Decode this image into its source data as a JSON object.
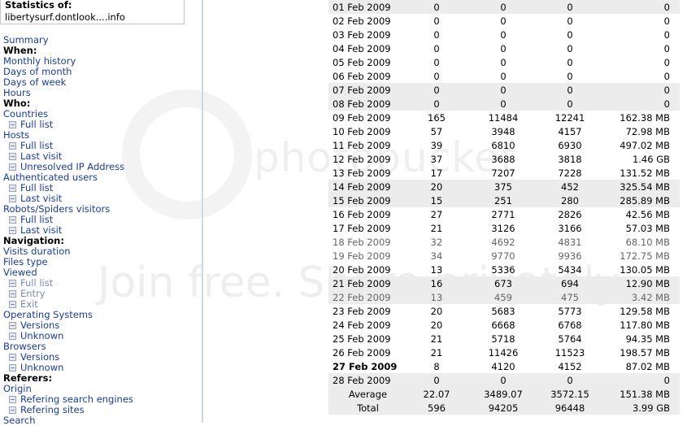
{
  "sidebar": {
    "stats_title": "Statistics of:",
    "site": "libertysurf.dontlook....info",
    "items": [
      {
        "label": "Summary",
        "kind": "l"
      },
      {
        "label": "When:",
        "kind": "h"
      },
      {
        "label": "Monthly history",
        "kind": "l"
      },
      {
        "label": "Days of month",
        "kind": "l"
      },
      {
        "label": "Days of week",
        "kind": "l"
      },
      {
        "label": "Hours",
        "kind": "l"
      },
      {
        "label": "Who:",
        "kind": "h"
      },
      {
        "label": "Countries",
        "kind": "l"
      },
      {
        "label": "Full list",
        "kind": "s"
      },
      {
        "label": "Hosts",
        "kind": "l"
      },
      {
        "label": "Full list",
        "kind": "s"
      },
      {
        "label": "Last visit",
        "kind": "s"
      },
      {
        "label": "Unresolved IP Address",
        "kind": "s"
      },
      {
        "label": "Authenticated users",
        "kind": "l"
      },
      {
        "label": "Full list",
        "kind": "s"
      },
      {
        "label": "Last visit",
        "kind": "s"
      },
      {
        "label": "Robots/Spiders visitors",
        "kind": "l"
      },
      {
        "label": "Full list",
        "kind": "s"
      },
      {
        "label": "Last visit",
        "kind": "s"
      },
      {
        "label": "Navigation:",
        "kind": "h"
      },
      {
        "label": "Visits duration",
        "kind": "l"
      },
      {
        "label": "Files type",
        "kind": "l"
      },
      {
        "label": "Viewed",
        "kind": "l"
      },
      {
        "label": "Full list",
        "kind": "s"
      },
      {
        "label": "Entry",
        "kind": "s"
      },
      {
        "label": "Exit",
        "kind": "s"
      },
      {
        "label": "Operating Systems",
        "kind": "l"
      },
      {
        "label": "Versions",
        "kind": "s"
      },
      {
        "label": "Unknown",
        "kind": "s"
      },
      {
        "label": "Browsers",
        "kind": "l"
      },
      {
        "label": "Versions",
        "kind": "s"
      },
      {
        "label": "Unknown",
        "kind": "s"
      },
      {
        "label": "Referers:",
        "kind": "h"
      },
      {
        "label": "Origin",
        "kind": "l"
      },
      {
        "label": "Refering search engines",
        "kind": "s"
      },
      {
        "label": "Refering sites",
        "kind": "s"
      },
      {
        "label": "Search",
        "kind": "l"
      }
    ]
  },
  "watermark": {
    "line1": "photobucket",
    "line2": "Join free. Share privately."
  },
  "legend_colors": [
    "#f5e64a",
    "#5d86d6",
    "#8fe0e8",
    "#4a9a4a"
  ],
  "rows": [
    {
      "date": "01 Feb 2009",
      "v1": "0",
      "v2": "0",
      "v3": "0",
      "bw": "0",
      "weekend": true
    },
    {
      "date": "02 Feb 2009",
      "v1": "0",
      "v2": "0",
      "v3": "0",
      "bw": "0"
    },
    {
      "date": "03 Feb 2009",
      "v1": "0",
      "v2": "0",
      "v3": "0",
      "bw": "0"
    },
    {
      "date": "04 Feb 2009",
      "v1": "0",
      "v2": "0",
      "v3": "0",
      "bw": "0"
    },
    {
      "date": "05 Feb 2009",
      "v1": "0",
      "v2": "0",
      "v3": "0",
      "bw": "0"
    },
    {
      "date": "06 Feb 2009",
      "v1": "0",
      "v2": "0",
      "v3": "0",
      "bw": "0"
    },
    {
      "date": "07 Feb 2009",
      "v1": "0",
      "v2": "0",
      "v3": "0",
      "bw": "0",
      "weekend": true
    },
    {
      "date": "08 Feb 2009",
      "v1": "0",
      "v2": "0",
      "v3": "0",
      "bw": "0",
      "weekend": true
    },
    {
      "date": "09 Feb 2009",
      "v1": "165",
      "v2": "11484",
      "v3": "12241",
      "bw": "162.38 MB"
    },
    {
      "date": "10 Feb 2009",
      "v1": "57",
      "v2": "3948",
      "v3": "4157",
      "bw": "72.98 MB"
    },
    {
      "date": "11 Feb 2009",
      "v1": "39",
      "v2": "6810",
      "v3": "6930",
      "bw": "497.02 MB"
    },
    {
      "date": "12 Feb 2009",
      "v1": "37",
      "v2": "3688",
      "v3": "3818",
      "bw": "1.46 GB"
    },
    {
      "date": "13 Feb 2009",
      "v1": "17",
      "v2": "7207",
      "v3": "7228",
      "bw": "131.52 MB"
    },
    {
      "date": "14 Feb 2009",
      "v1": "20",
      "v2": "375",
      "v3": "452",
      "bw": "325.54 MB",
      "weekend": true
    },
    {
      "date": "15 Feb 2009",
      "v1": "15",
      "v2": "251",
      "v3": "280",
      "bw": "285.89 MB",
      "weekend": true
    },
    {
      "date": "16 Feb 2009",
      "v1": "27",
      "v2": "2771",
      "v3": "2826",
      "bw": "42.56 MB"
    },
    {
      "date": "17 Feb 2009",
      "v1": "21",
      "v2": "3126",
      "v3": "3166",
      "bw": "57.03 MB"
    },
    {
      "date": "18 Feb 2009",
      "v1": "32",
      "v2": "4692",
      "v3": "4831",
      "bw": "68.10 MB",
      "fade": true
    },
    {
      "date": "19 Feb 2009",
      "v1": "34",
      "v2": "9770",
      "v3": "9936",
      "bw": "172.75 MB",
      "fade": true
    },
    {
      "date": "20 Feb 2009",
      "v1": "13",
      "v2": "5336",
      "v3": "5434",
      "bw": "130.05 MB"
    },
    {
      "date": "21 Feb 2009",
      "v1": "16",
      "v2": "673",
      "v3": "694",
      "bw": "12.90 MB",
      "weekend": true
    },
    {
      "date": "22 Feb 2009",
      "v1": "13",
      "v2": "459",
      "v3": "475",
      "bw": "3.42 MB",
      "weekend": true,
      "fade": true
    },
    {
      "date": "23 Feb 2009",
      "v1": "20",
      "v2": "5683",
      "v3": "5773",
      "bw": "129.58 MB"
    },
    {
      "date": "24 Feb 2009",
      "v1": "20",
      "v2": "6668",
      "v3": "6768",
      "bw": "117.80 MB"
    },
    {
      "date": "25 Feb 2009",
      "v1": "21",
      "v2": "5718",
      "v3": "5764",
      "bw": "94.35 MB"
    },
    {
      "date": "26 Feb 2009",
      "v1": "21",
      "v2": "11426",
      "v3": "11523",
      "bw": "198.57 MB"
    },
    {
      "date": "27 Feb 2009",
      "v1": "8",
      "v2": "4120",
      "v3": "4152",
      "bw": "87.02 MB",
      "bold": true
    },
    {
      "date": "28 Feb 2009",
      "v1": "0",
      "v2": "0",
      "v3": "0",
      "bw": "0",
      "weekend": true
    }
  ],
  "summary": [
    {
      "label": "Average",
      "v1": "22.07",
      "v2": "3489.07",
      "v3": "3572.15",
      "bw": "151.38 MB"
    },
    {
      "label": "Total",
      "v1": "596",
      "v2": "94205",
      "v3": "96448",
      "bw": "3.99 GB"
    }
  ]
}
